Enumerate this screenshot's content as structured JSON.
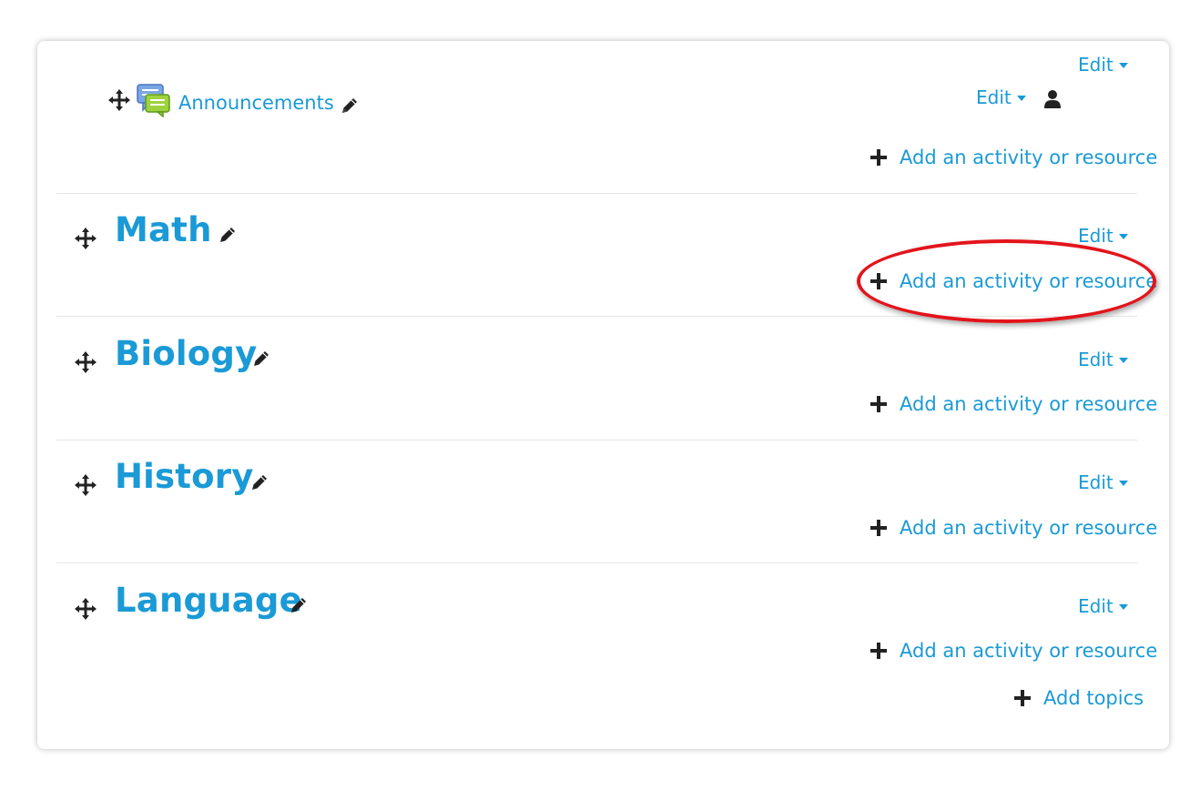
{
  "colors": {
    "link": "#1a9ad6",
    "icon": "#222222",
    "highlight": "#e3141b"
  },
  "general": {
    "edit_label": "Edit",
    "activity": {
      "name": "Announcements",
      "icon": "forum-icon",
      "edit_label": "Edit",
      "user_icon": "user-icon"
    },
    "add_activity_label": "Add an activity or resource"
  },
  "sections": [
    {
      "title": "Math",
      "edit_label": "Edit",
      "add_activity_label": "Add an activity or resource",
      "highlighted": true
    },
    {
      "title": "Biology",
      "edit_label": "Edit",
      "add_activity_label": "Add an activity or resource"
    },
    {
      "title": "History",
      "edit_label": "Edit",
      "add_activity_label": "Add an activity or resource"
    },
    {
      "title": "Language",
      "edit_label": "Edit",
      "add_activity_label": "Add an activity or resource"
    }
  ],
  "footer": {
    "add_topics_label": "Add topics"
  }
}
